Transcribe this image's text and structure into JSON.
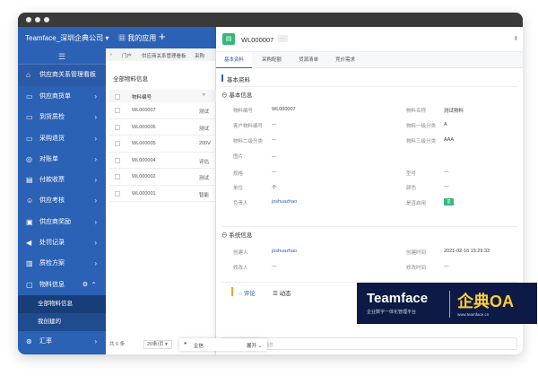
{
  "header": {
    "company": "Teamface_深圳企典公司",
    "my_apps": "我的应用",
    "add": "+"
  },
  "sidebar": {
    "collapse": "☰",
    "items": [
      {
        "label": "供应商关系管理看板",
        "icon": "home-icon"
      },
      {
        "label": "供应商货单",
        "icon": "cart-icon"
      },
      {
        "label": "到货质检",
        "icon": "cart-icon"
      },
      {
        "label": "采购退货",
        "icon": "cart-icon"
      },
      {
        "label": "对账单",
        "icon": "target-icon"
      },
      {
        "label": "付款收票",
        "icon": "document-icon"
      },
      {
        "label": "供应考核",
        "icon": "person-icon"
      },
      {
        "label": "供应商奖励",
        "icon": "chart-icon"
      },
      {
        "label": "处罚记录",
        "icon": "megaphone-icon"
      },
      {
        "label": "质检方案",
        "icon": "book-icon"
      },
      {
        "label": "物料信息",
        "icon": "box-icon"
      }
    ],
    "sub_items": [
      "全部物料信息",
      "我创建的"
    ],
    "last_item": {
      "label": "汇率",
      "icon": "rate-icon"
    }
  },
  "tabs": [
    "门户",
    "供应商关系管理看板",
    "采购"
  ],
  "list": {
    "title": "全部物料信息",
    "col_header": "物料编号",
    "rows": [
      "WL000007",
      "WL000006",
      "WL000005",
      "WL000004",
      "WL000002",
      "WL000001"
    ],
    "row_extra": [
      "测试",
      "测试",
      "200V",
      "评估",
      "测试",
      "智能"
    ],
    "total": "共 6 条",
    "page_size": "20条/页"
  },
  "detail": {
    "title": "WL000007",
    "tabs": [
      "基本资料",
      "采购配额",
      "货源清单",
      "竞价需求"
    ],
    "section_main": "基本资料",
    "section_basic": "基本信息",
    "fields_left": [
      {
        "label": "物料编号",
        "value": "WL000007"
      },
      {
        "label": "客户物料编号",
        "value": "---"
      },
      {
        "label": "物料二级分类",
        "value": "---"
      },
      {
        "label": "图片",
        "value": "---"
      },
      {
        "label": "规格",
        "value": "---"
      },
      {
        "label": "单位",
        "value": "个"
      },
      {
        "label": "负责人",
        "value": "joshuazhao"
      }
    ],
    "fields_right": [
      {
        "label": "物料名称",
        "value": "测试物料"
      },
      {
        "label": "物料一级分类",
        "value": "A"
      },
      {
        "label": "物料三级分类",
        "value": "AAA"
      },
      {
        "label": "型号",
        "value": "---"
      },
      {
        "label": "颜色",
        "value": "---"
      },
      {
        "label": "是否启用",
        "value": "是"
      }
    ],
    "section_system": "系统信息",
    "sys_left": [
      {
        "label": "创建人",
        "value": "joshuazhao"
      },
      {
        "label": "修改人",
        "value": "---"
      }
    ],
    "sys_right": [
      {
        "label": "创建时间",
        "value": "2021-02-16 15:29:33"
      },
      {
        "label": "修改时间",
        "value": "---"
      }
    ],
    "comment_tab": "评论",
    "activity_tab": "动态",
    "comment_placeholder": "按Enter发送消息",
    "avatar": "joshua"
  },
  "chat": {
    "label": "企信",
    "expand": "展开"
  },
  "brand": {
    "name": "Teamface",
    "tagline": "企业数字一体化管理平台",
    "oa": "企典OA",
    "url": "www.teamface.cn"
  },
  "colors": {
    "primary": "#2c62b5",
    "accent_green": "#34b77a",
    "brand_bg": "#0d1a45",
    "brand_yellow": "#ffce33"
  }
}
